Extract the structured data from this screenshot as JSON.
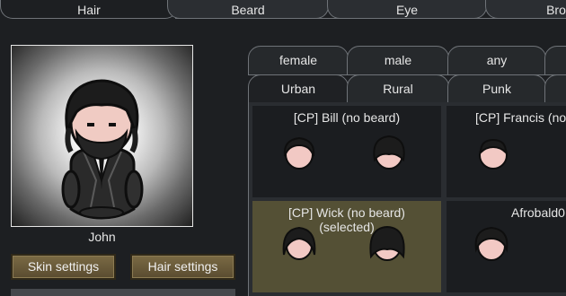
{
  "top_tabs": [
    {
      "label": "Hair",
      "active": true
    },
    {
      "label": "Beard",
      "active": false
    },
    {
      "label": "Eye",
      "active": false
    },
    {
      "label": "Bro",
      "active": false
    }
  ],
  "pawn": {
    "name": "John"
  },
  "buttons": {
    "skin": "Skin settings",
    "hair": "Hair settings"
  },
  "gender_tabs": [
    {
      "label": "female"
    },
    {
      "label": "male"
    },
    {
      "label": "any"
    },
    {
      "label": ""
    }
  ],
  "category_tabs": [
    {
      "label": "Urban",
      "selected": true
    },
    {
      "label": "Rural",
      "selected": false
    },
    {
      "label": "Punk",
      "selected": false
    },
    {
      "label": "",
      "selected": false
    }
  ],
  "hair_styles": [
    {
      "label": "[CP] Bill (no beard)",
      "selected": false,
      "icons": [
        "head-front-icon",
        "hair-back-icon"
      ]
    },
    {
      "label": "[CP] Francis (no",
      "selected": false,
      "icons": [
        "head-front-icon"
      ]
    },
    {
      "label": "[CP] Wick (no beard)\n(selected)",
      "selected": true,
      "icons": [
        "head-front-icon",
        "hair-back-icon"
      ]
    },
    {
      "label": "Afrobald0",
      "selected": false,
      "icons": [
        "head-front-icon"
      ]
    }
  ],
  "colors": {
    "background": "#1d1f22",
    "button": "#6b5b3a",
    "selected_cell": "#545035",
    "skin": "#f2c9c4",
    "hair": "#1c1c1c"
  }
}
